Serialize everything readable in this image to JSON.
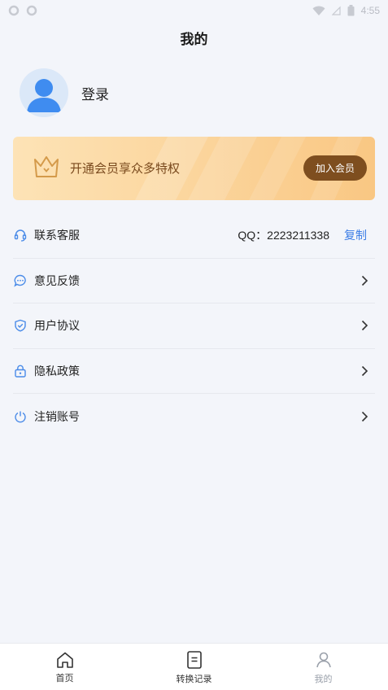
{
  "status_bar": {
    "time": "4:55"
  },
  "header": {
    "title": "我的"
  },
  "profile": {
    "login_label": "登录"
  },
  "vip": {
    "text": "开通会员享众多特权",
    "button_label": "加入会员"
  },
  "menu": {
    "items": [
      {
        "label": "联系客服",
        "icon": "headset-icon",
        "qq": "QQ：2223211338",
        "action": "复制"
      },
      {
        "label": "意见反馈",
        "icon": "chat-bubble-icon"
      },
      {
        "label": "用户协议",
        "icon": "shield-check-icon"
      },
      {
        "label": "隐私政策",
        "icon": "lock-icon"
      },
      {
        "label": "注销账号",
        "icon": "power-icon"
      }
    ]
  },
  "bottom_nav": {
    "items": [
      {
        "label": "首页",
        "icon": "home-icon"
      },
      {
        "label": "转换记录",
        "icon": "document-icon"
      },
      {
        "label": "我的",
        "icon": "user-icon"
      }
    ]
  },
  "colors": {
    "accent": "#3d7ee6",
    "vip_button": "#7e4e1f",
    "vip_text": "#7a4a1e",
    "icon": "#4a8be8"
  }
}
